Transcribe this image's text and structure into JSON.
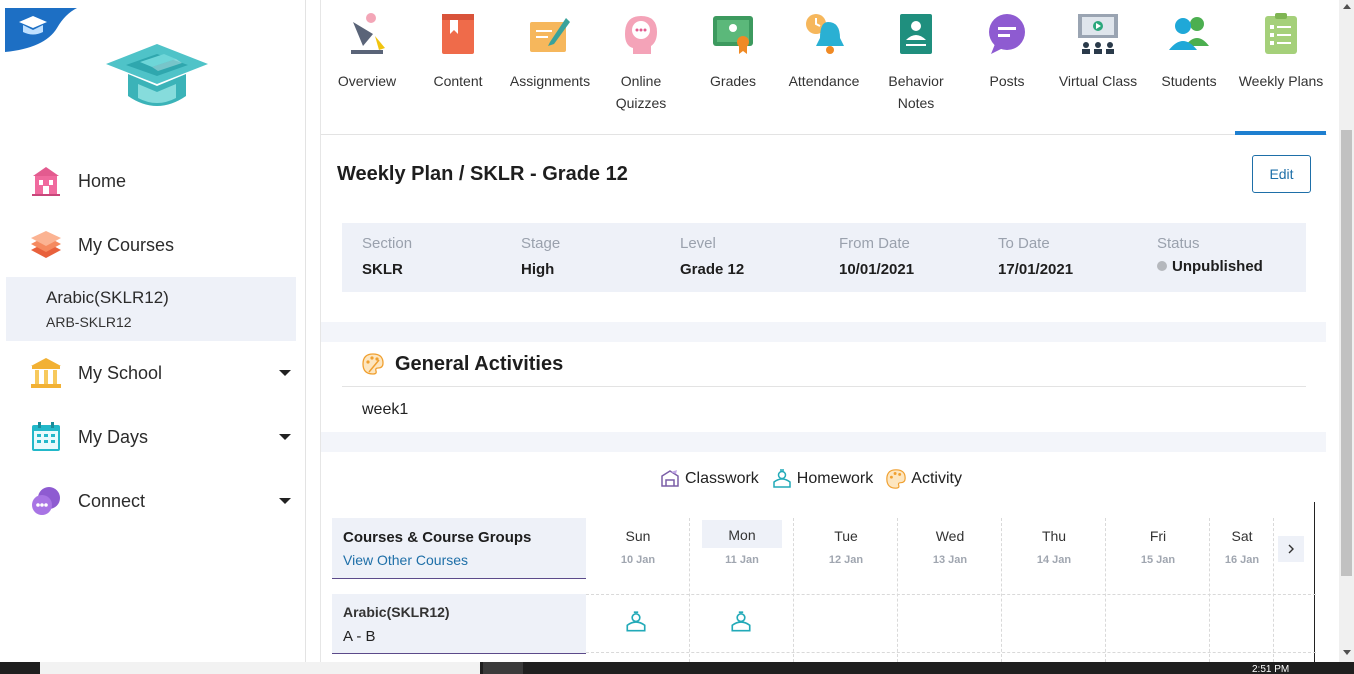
{
  "sidebar": {
    "nav": [
      {
        "label": "Home",
        "icon": "school-building-icon"
      },
      {
        "label": "My Courses",
        "icon": "stacked-books-icon"
      },
      {
        "label": "My School",
        "icon": "columns-building-icon"
      },
      {
        "label": "My Days",
        "icon": "calendar-icon"
      },
      {
        "label": "Connect",
        "icon": "chat-bubbles-icon"
      }
    ],
    "active_course": {
      "name": "Arabic(SKLR12)",
      "code": "ARB-SKLR12"
    }
  },
  "tabs": [
    {
      "label": "Overview",
      "icon": "desk-lamp-icon"
    },
    {
      "label": "Content",
      "icon": "book-icon"
    },
    {
      "label": "Assignments",
      "icon": "pencil-paper-icon"
    },
    {
      "label": "Online\nQuizzes",
      "icon": "head-chat-icon"
    },
    {
      "label": "Grades",
      "icon": "certificate-icon"
    },
    {
      "label": "Attendance",
      "icon": "bell-clock-icon"
    },
    {
      "label": "Behavior\nNotes",
      "icon": "id-card-icon"
    },
    {
      "label": "Posts",
      "icon": "speech-bubble-icon"
    },
    {
      "label": "Virtual Class",
      "icon": "presentation-screen-icon"
    },
    {
      "label": "Students",
      "icon": "users-icon"
    },
    {
      "label": "Weekly Plans",
      "icon": "clipboard-list-icon"
    }
  ],
  "plan": {
    "title": "Weekly Plan / SKLR - Grade 12",
    "edit_label": "Edit",
    "info": [
      {
        "label": "Section",
        "value": "SKLR"
      },
      {
        "label": "Stage",
        "value": "High"
      },
      {
        "label": "Level",
        "value": "Grade 12"
      },
      {
        "label": "From Date",
        "value": "10/01/2021"
      },
      {
        "label": "To Date",
        "value": "17/01/2021"
      },
      {
        "label": "Status",
        "value": "Unpublished"
      }
    ]
  },
  "general": {
    "title": "General Activities",
    "text": "week1"
  },
  "legend": [
    {
      "label": "Classwork",
      "icon": "classwork-icon"
    },
    {
      "label": "Homework",
      "icon": "homework-icon"
    },
    {
      "label": "Activity",
      "icon": "activity-palette-icon"
    }
  ],
  "grid": {
    "header_title": "Courses & Course Groups",
    "header_link": "View Other Courses",
    "days": [
      {
        "name": "Sun",
        "date": "10 Jan"
      },
      {
        "name": "Mon",
        "date": "11 Jan"
      },
      {
        "name": "Tue",
        "date": "12 Jan"
      },
      {
        "name": "Wed",
        "date": "13 Jan"
      },
      {
        "name": "Thu",
        "date": "14 Jan"
      },
      {
        "name": "Fri",
        "date": "15 Jan"
      },
      {
        "name": "Sat",
        "date": "16 Jan"
      }
    ],
    "row": {
      "name": "Arabic(SKLR12)",
      "group": "A - B"
    }
  },
  "taskbar": {
    "clock": "2:51 PM"
  },
  "colors": {
    "accent": "#1e7fd0",
    "link": "#1e6fa8",
    "panel": "#eef1f8",
    "row_border": "#5b4a8a"
  }
}
